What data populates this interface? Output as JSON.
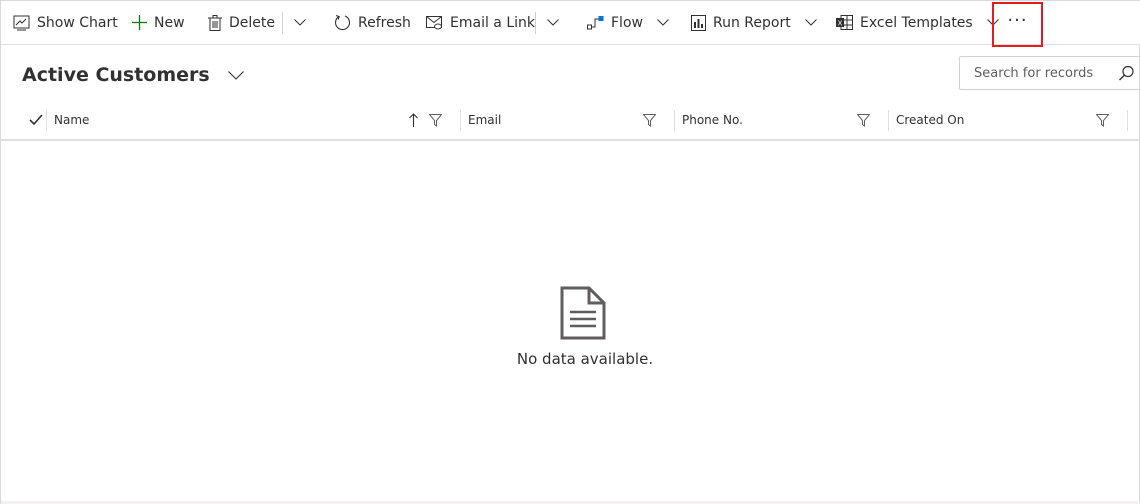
{
  "command_bar": {
    "show_chart": "Show Chart",
    "new": "New",
    "delete": "Delete",
    "refresh": "Refresh",
    "email_link": "Email a Link",
    "flow": "Flow",
    "run_report": "Run Report",
    "excel_templates": "Excel Templates",
    "more": "···"
  },
  "view": {
    "title": "Active Customers"
  },
  "search": {
    "placeholder": "Search for records"
  },
  "grid": {
    "columns": [
      {
        "label": "Name"
      },
      {
        "label": "Email"
      },
      {
        "label": "Phone No."
      },
      {
        "label": "Created On"
      }
    ],
    "rows": []
  },
  "empty_state": {
    "message": "No data available."
  },
  "colors": {
    "accent": "#0078d4",
    "text": "#323130",
    "highlight": "#e31b23",
    "divider": "#e1dfdd"
  },
  "icons": {
    "show_chart": "chart-icon",
    "new": "plus-icon",
    "delete": "trash-icon",
    "refresh": "refresh-icon",
    "email_link": "email-link-icon",
    "flow": "flow-icon",
    "run_report": "report-icon",
    "excel_templates": "excel-icon",
    "search": "search-icon",
    "empty": "document-icon"
  }
}
